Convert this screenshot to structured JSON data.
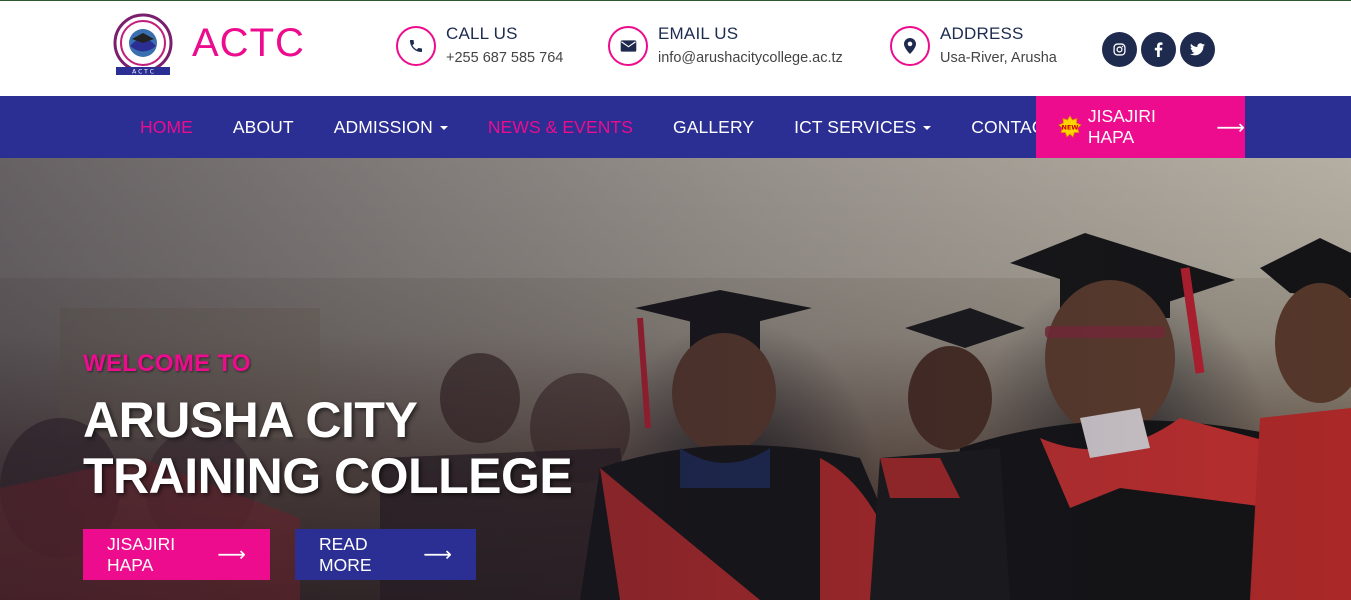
{
  "brand": {
    "name": "ACTC",
    "seal_letters": "A C T C"
  },
  "contacts": {
    "call": {
      "title": "CALL US",
      "value": "+255 687 585 764",
      "icon": "phone-icon"
    },
    "email": {
      "title": "EMAIL US",
      "value": "info@arushacitycollege.ac.tz",
      "icon": "envelope-icon"
    },
    "address": {
      "title": "ADDRESS",
      "value": "Usa-River, Arusha",
      "icon": "map-pin-icon"
    }
  },
  "socials": [
    "instagram-icon",
    "facebook-icon",
    "twitter-icon"
  ],
  "nav": {
    "items": [
      {
        "label": "HOME",
        "active": true
      },
      {
        "label": "ABOUT"
      },
      {
        "label": "ADMISSION",
        "dropdown": true
      },
      {
        "label": "NEWS & EVENTS",
        "highlight": true
      },
      {
        "label": "GALLERY"
      },
      {
        "label": "ICT SERVICES",
        "dropdown": true
      },
      {
        "label": "CONTACT"
      }
    ],
    "cta": {
      "label": "JISAJIRI HAPA",
      "badge": "NEW"
    }
  },
  "hero": {
    "kicker": "WELCOME TO",
    "title_line1": "ARUSHA CITY",
    "title_line2": "TRAINING COLLEGE",
    "buttons": {
      "primary": "JISAJIRI HAPA",
      "secondary": "READ MORE"
    }
  },
  "colors": {
    "pink": "#ec0c8d",
    "navy": "#2b2f93",
    "dark": "#1e2a4e"
  }
}
